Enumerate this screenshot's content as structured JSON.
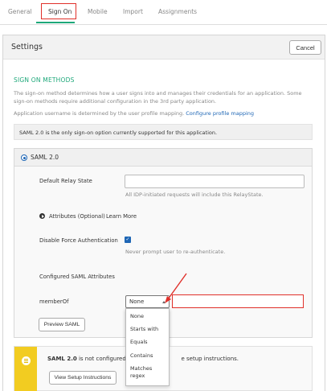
{
  "tabs": [
    "General",
    "Sign On",
    "Mobile",
    "Import",
    "Assignments"
  ],
  "panel": {
    "title": "Settings",
    "cancel_label": "Cancel"
  },
  "sign_on": {
    "section_title": "SIGN ON METHODS",
    "description": "The sign-on method determines how a user signs into and manages their credentials for an application. Some sign-on methods require additional configuration in the 3rd party application.",
    "username_text": "Application username is determined by the user profile mapping.",
    "username_link": "Configure profile mapping",
    "info": "SAML 2.0 is the only sign-on option currently supported for this application."
  },
  "saml": {
    "label": "SAML 2.0",
    "relay_state_label": "Default Relay State",
    "relay_state_value": "",
    "relay_state_help": "All IDP-initiated requests will include this RelayState.",
    "attributes_label": "Attributes (Optional)",
    "learn_more": "Learn More",
    "disable_force_label": "Disable Force Authentication",
    "disable_force_checked": true,
    "disable_force_help": "Never prompt user to re-authenticate.",
    "configured_attrs_label": "Configured SAML Attributes",
    "member_of_label": "memberOf",
    "member_of_selected": "None",
    "member_of_value": "",
    "options": [
      "None",
      "Starts with",
      "Equals",
      "Contains",
      "Matches regex"
    ],
    "preview_label": "Preview SAML"
  },
  "warning": {
    "text_before": "SAML 2.0",
    "text_mid": "is not configured u",
    "text_after": "e setup instructions.",
    "button": "View Setup Instructions"
  },
  "colors": {
    "accent": "#1ea87a",
    "link": "#1e66b5",
    "annotation": "#e0302a",
    "warning": "#f2cc21"
  }
}
